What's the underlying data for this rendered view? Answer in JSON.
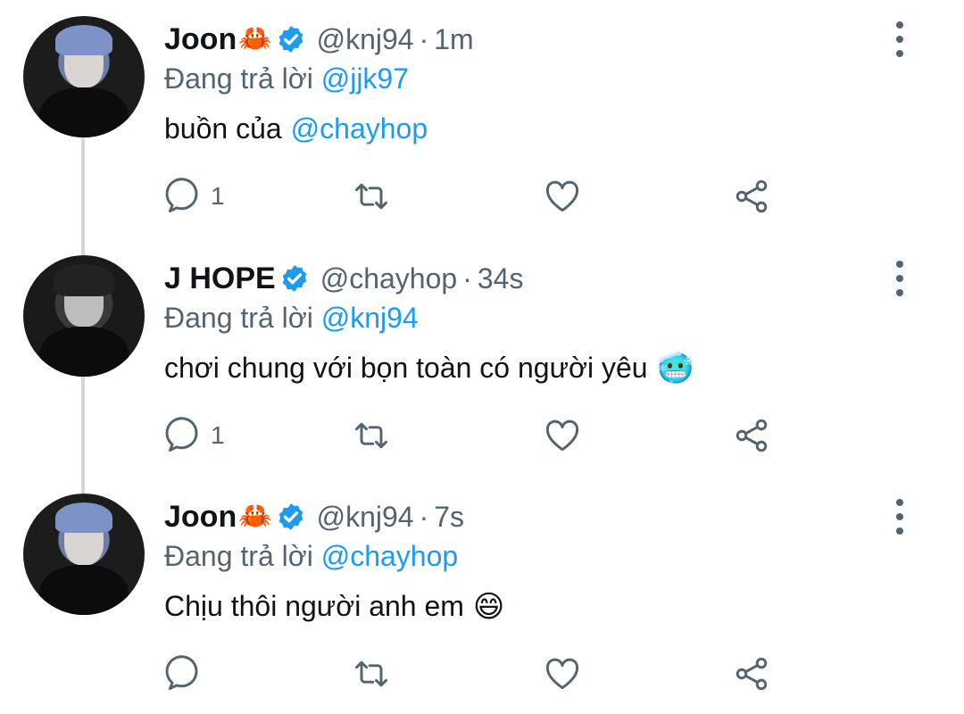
{
  "tweets": [
    {
      "name": "Joon",
      "name_emoji": "🦀",
      "handle": "@knj94",
      "time": "1m",
      "reply_prefix": "Đang trả lời",
      "reply_to": "@jjk97",
      "text": "buồn của",
      "text_mention": "@chayhop",
      "text_emoji": "",
      "reply_count": "1",
      "avatar": "joon"
    },
    {
      "name": "J HOPE",
      "name_emoji": "",
      "handle": "@chayhop",
      "time": "34s",
      "reply_prefix": "Đang trả lời",
      "reply_to": "@knj94",
      "text": "chơi chung với bọn toàn có người yêu",
      "text_mention": "",
      "text_emoji": "🥶",
      "reply_count": "1",
      "avatar": "jhope"
    },
    {
      "name": "Joon",
      "name_emoji": "🦀",
      "handle": "@knj94",
      "time": "7s",
      "reply_prefix": "Đang trả lời",
      "reply_to": "@chayhop",
      "text": "Chịu thôi người anh em",
      "text_mention": "",
      "text_emoji": "😄",
      "reply_count": "",
      "avatar": "joon"
    }
  ],
  "separator": "·",
  "colors": {
    "accent": "#1d9bf0",
    "muted": "#536471",
    "text": "#0f1419",
    "thread_line": "#cfd9de"
  },
  "icons": {
    "reply": "reply-icon",
    "retweet": "retweet-icon",
    "like": "heart-icon",
    "share": "share-icon",
    "verified": "verified-badge-icon",
    "more": "more-vertical-icon"
  }
}
